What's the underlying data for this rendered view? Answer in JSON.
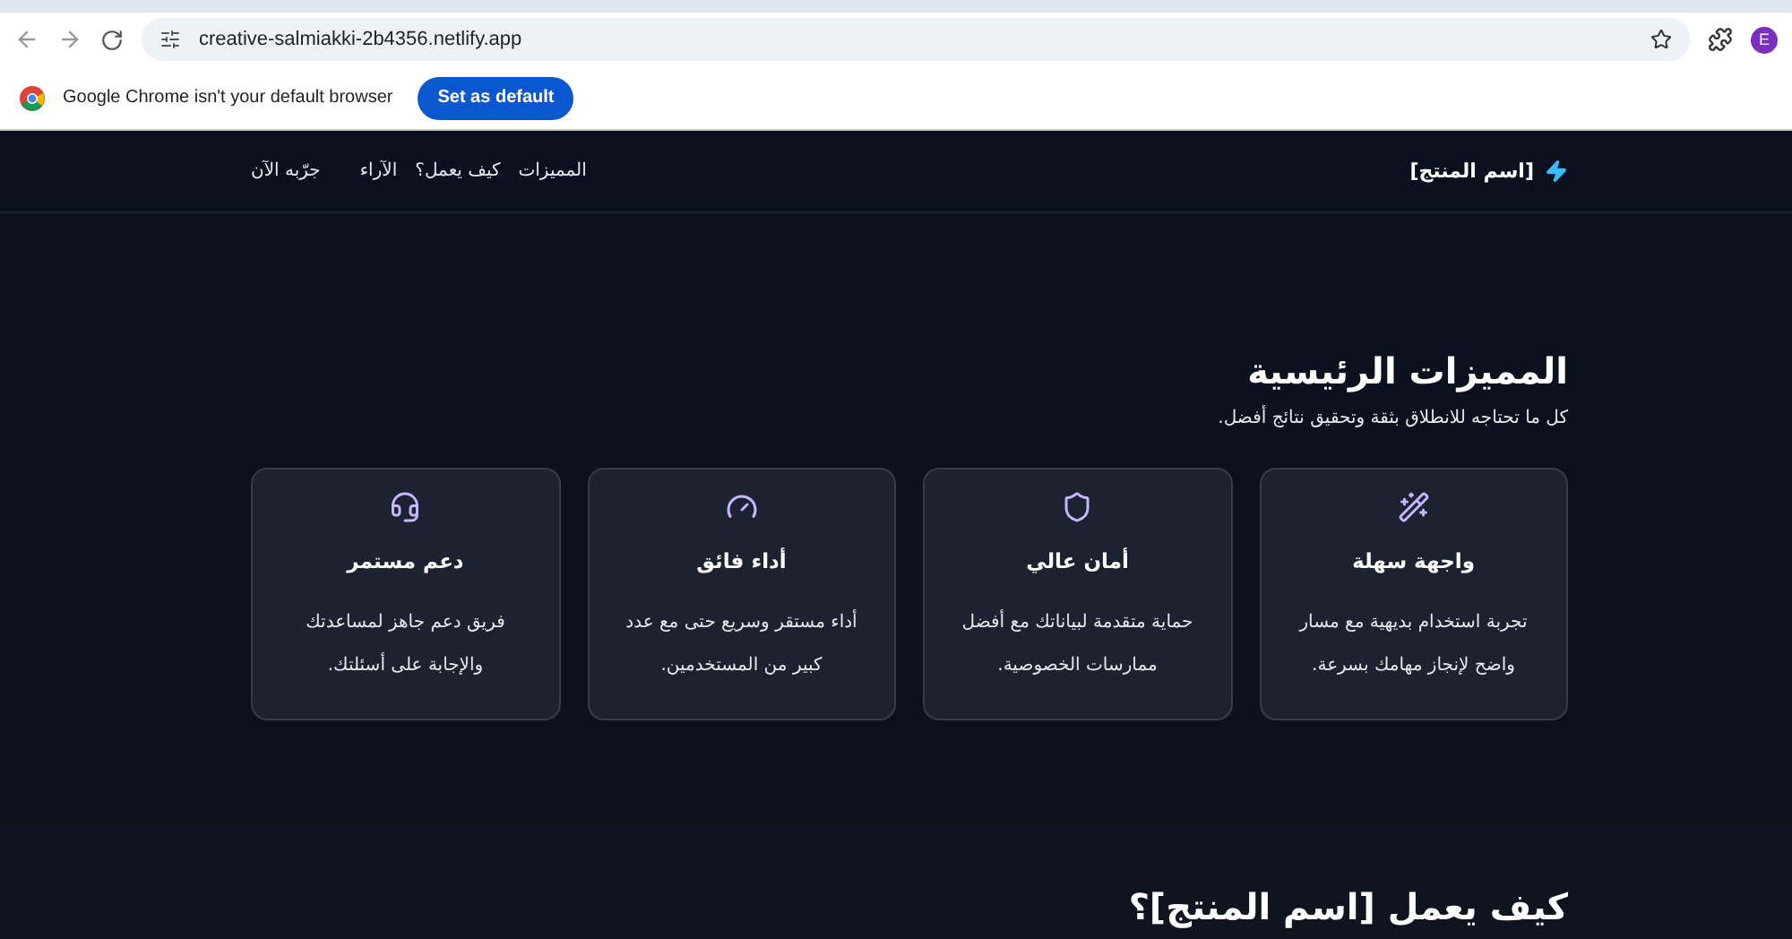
{
  "browser": {
    "url": "creative-salmiakki-2b4356.netlify.app",
    "profile_initial": "E",
    "infobar": {
      "message": "Google Chrome isn't your default browser",
      "button": "Set as default"
    }
  },
  "nav": {
    "brand": "[اسم المنتج]",
    "links": [
      {
        "label": "المميزات"
      },
      {
        "label": "كيف يعمل؟"
      },
      {
        "label": "الآراء"
      },
      {
        "label": "جرّبه الآن"
      }
    ]
  },
  "features": {
    "title": "المميزات الرئيسية",
    "subtitle": "كل ما تحتاجه للانطلاق بثقة وتحقيق نتائج أفضل.",
    "cards": [
      {
        "kind": "wand",
        "title": "واجهة سهلة",
        "text": "تجربة استخدام بديهية مع مسار واضح لإنجاز مهامك بسرعة."
      },
      {
        "kind": "shield",
        "title": "أمان عالي",
        "text": "حماية متقدمة لبياناتك مع أفضل ممارسات الخصوصية."
      },
      {
        "kind": "gauge",
        "title": "أداء فائق",
        "text": "أداء مستقر وسريع حتى مع عدد كبير من المستخدمين."
      },
      {
        "kind": "headset",
        "title": "دعم مستمر",
        "text": "فريق دعم جاهز لمساعدتك والإجابة على أسئلتك."
      }
    ]
  },
  "next_section": {
    "title": "كيف يعمل [اسم المنتج]؟"
  }
}
